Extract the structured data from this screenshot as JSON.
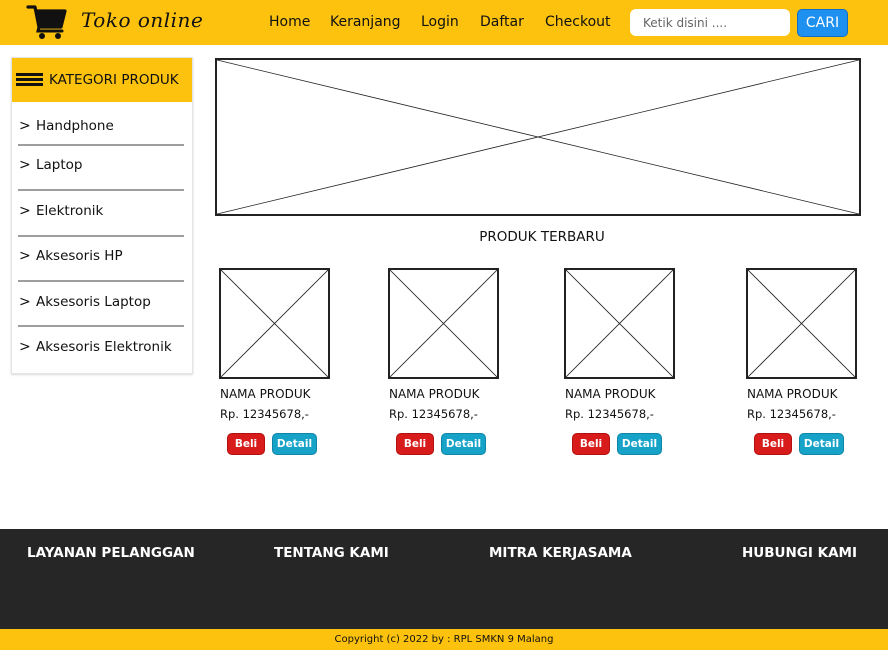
{
  "header": {
    "brand": "Toko online",
    "logo_icon": "shopping-cart-icon",
    "nav": [
      "Home",
      "Keranjang",
      "Login",
      "Daftar",
      "Checkout"
    ],
    "search_placeholder": "Ketik disini ....",
    "search_button": "CARI",
    "colors": {
      "bar": "#fcc20e",
      "search_button": "#1e90f0"
    }
  },
  "sidebar": {
    "title": "KATEGORI PRODUK",
    "menu_icon": "hamburger-icon",
    "items": [
      {
        "arrow": ">",
        "label": "Handphone"
      },
      {
        "arrow": ">",
        "label": "Laptop"
      },
      {
        "arrow": ">",
        "label": "Elektronik"
      },
      {
        "arrow": ">",
        "label": "Aksesoris HP"
      },
      {
        "arrow": ">",
        "label": "Aksesoris Laptop"
      },
      {
        "arrow": ">",
        "label": "Aksesoris Elektronik"
      }
    ]
  },
  "main": {
    "banner_icon": "image-placeholder-icon",
    "section_title": "PRODUK TERBARU",
    "products": [
      {
        "name": "NAMA PRODUK",
        "price": "Rp. 12345678,-",
        "buy_label": "Beli",
        "detail_label": "Detail"
      },
      {
        "name": "NAMA PRODUK",
        "price": "Rp. 12345678,-",
        "buy_label": "Beli",
        "detail_label": "Detail"
      },
      {
        "name": "NAMA PRODUK",
        "price": "Rp. 12345678,-",
        "buy_label": "Beli",
        "detail_label": "Detail"
      },
      {
        "name": "NAMA PRODUK",
        "price": "Rp. 12345678,-",
        "buy_label": "Beli",
        "detail_label": "Detail"
      }
    ],
    "colors": {
      "buy": "#d81b1b",
      "detail": "#17a2c8"
    }
  },
  "footer": {
    "columns": [
      "LAYANAN PELANGGAN",
      "TENTANG KAMI",
      "MITRA KERJASAMA",
      "HUBUNGI KAMI"
    ],
    "copyright": "Copyright (c) 2022 by : RPL SMKN 9 Malang",
    "colors": {
      "background": "#262626",
      "copyright_bar": "#fcc20e"
    }
  }
}
